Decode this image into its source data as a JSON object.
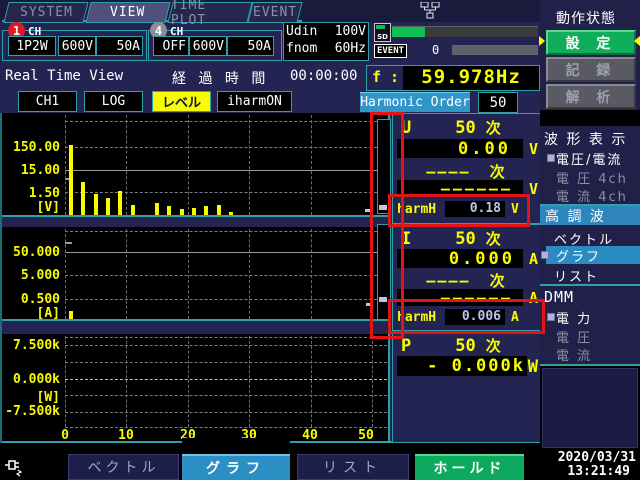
{
  "tabs": {
    "items": [
      {
        "label": "SYSTEM"
      },
      {
        "label": "VIEW"
      },
      {
        "label": "TIME PLOT"
      },
      {
        "label": "EVENT"
      }
    ],
    "selected": "VIEW"
  },
  "header": {
    "ch1": {
      "num": "1",
      "ch_label": "CH",
      "wiring": "1P2W",
      "voltage": "600V",
      "current": "50A"
    },
    "ch4": {
      "num": "4",
      "ch_label": "CH",
      "mode": "OFF",
      "voltage": "600V",
      "current": "50A"
    },
    "udin_label": "Udin",
    "udin_value": "100V",
    "fnom_label": "fnom",
    "fnom_value": "60Hz",
    "sd_label": "SD",
    "event_label": "EVENT",
    "event_count": "0"
  },
  "status": {
    "view_label": "Real Time View",
    "elapsed_label": "経 過 時 間",
    "elapsed_value": "00:00:00",
    "freq_label": "f :",
    "freq_value": "59.978Hz"
  },
  "controls": {
    "ch_button": "CH1",
    "log_button": "LOG",
    "level_button": "レベル",
    "iharm_button": "iharmON",
    "harmonic_order_label": "Harmonic Order",
    "harmonic_order_value": "50"
  },
  "chart_data": [
    {
      "type": "bar",
      "name": "Voltage harmonic spectrum",
      "unit": "V",
      "yscale": "log",
      "yticks": [
        "150.00",
        "15.00",
        "1.50"
      ],
      "ylabel": "[V]",
      "x_range": [
        0,
        50
      ],
      "series": [
        {
          "name": "U",
          "x": [
            1,
            3,
            5,
            7,
            9,
            11,
            15,
            17,
            19,
            21,
            23,
            25,
            27
          ],
          "values": [
            140,
            3.7,
            1.2,
            0.8,
            1.6,
            0.41,
            0.48,
            0.35,
            0.28,
            0.3,
            0.37,
            0.41,
            0.21
          ]
        }
      ]
    },
    {
      "type": "bar",
      "name": "Current harmonic spectrum",
      "unit": "A",
      "yscale": "log",
      "yticks": [
        "50.000",
        "5.000",
        "0.500"
      ],
      "ylabel": "[A]",
      "x_range": [
        0,
        50
      ],
      "series": [
        {
          "name": "I",
          "x": [
            1
          ],
          "values": [
            0.115
          ]
        }
      ]
    },
    {
      "type": "bar",
      "name": "Power harmonic spectrum",
      "unit": "W",
      "yscale": "linear",
      "yticks": [
        "7.500k",
        "0.000k",
        "-7.500k"
      ],
      "ylabel": "[W]",
      "x_range": [
        0,
        50
      ],
      "xticks": [
        "0",
        "10",
        "20",
        "30",
        "40",
        "50"
      ],
      "series": [
        {
          "name": "P",
          "x": [],
          "values": []
        }
      ],
      "note": "all harmonic power values 0 - flat zero line"
    }
  ],
  "readouts": {
    "u": {
      "name": "U",
      "order": "50",
      "order_suffix": "次",
      "value": "0.00",
      "unit": "V",
      "dash_order": "––––",
      "dash_suffix": "次",
      "dash_value": "––––––",
      "dash_unit": "V",
      "harmh_label": "harmH",
      "harmh_value": "0.18",
      "harmh_unit": "V"
    },
    "i": {
      "name": "I",
      "order": "50",
      "order_suffix": "次",
      "value": "0.000",
      "unit": "A",
      "dash_order": "––––",
      "dash_suffix": "次",
      "dash_value": "––––––",
      "dash_unit": "A",
      "harmh_label": "harmH",
      "harmh_value": "0.006",
      "harmh_unit": "A"
    },
    "p": {
      "name": "P",
      "order": "50",
      "order_suffix": "次",
      "value": "- 0.000k",
      "unit": "W"
    }
  },
  "sidebar": {
    "section_status": {
      "title": "動作状態",
      "buttons": [
        {
          "label": "設 定",
          "state": "active"
        },
        {
          "label": "記 録",
          "state": "disabled"
        },
        {
          "label": "解 析",
          "state": "disabled"
        }
      ]
    },
    "section_waveform": {
      "title": "波 形 表 示",
      "items": [
        {
          "label": "電圧/電流",
          "state": "selected"
        },
        {
          "label": "電 圧 4ch",
          "state": "disabled"
        },
        {
          "label": "電 流 4ch",
          "state": "disabled"
        }
      ]
    },
    "section_harmonics": {
      "title": "高 調 波",
      "items": [
        {
          "label": "ベクトル",
          "state": "normal"
        },
        {
          "label": "グラフ",
          "state": "selected"
        },
        {
          "label": "リスト",
          "state": "normal"
        }
      ]
    },
    "section_dmm": {
      "title": "DMM",
      "items": [
        {
          "label": "電 力",
          "state": "selected"
        },
        {
          "label": "電 圧",
          "state": "disabled"
        },
        {
          "label": "電 流",
          "state": "disabled"
        }
      ]
    }
  },
  "bottom_bar": {
    "vector": "ベクトル",
    "graph": "グラフ",
    "list": "リスト",
    "hold": "ホールド",
    "selected": "グラフ"
  },
  "datetime": {
    "date": "2020/03/31",
    "time": "13:21:49"
  },
  "colors": {
    "accent_yellow": "#f8fc00",
    "teal_border": "#2fa0a8",
    "highlight_blue": "#2e8fc4",
    "active_green": "#10ae5a",
    "hold_green": "#0da95e",
    "annotation_red": "#e41414",
    "value_lavender": "#c0c4ec",
    "sd_green": "#0cc052"
  }
}
